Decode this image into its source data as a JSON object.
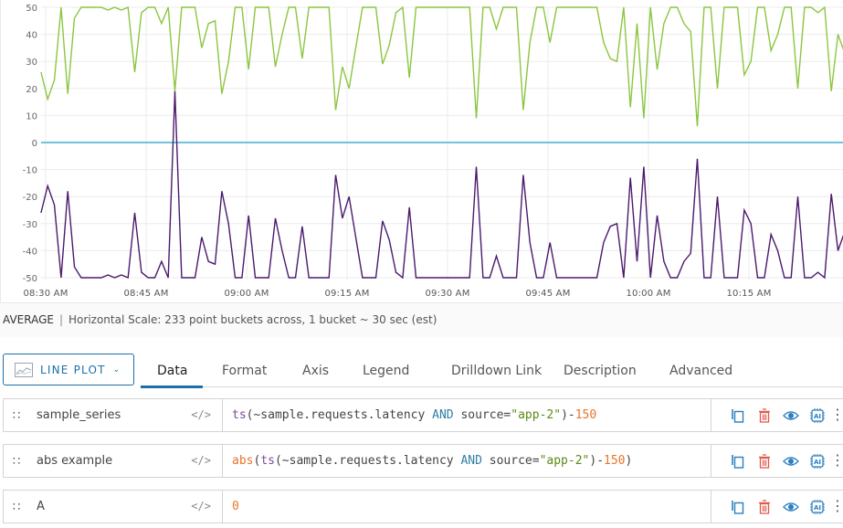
{
  "chart_data": {
    "type": "line",
    "title": "",
    "xlabel": "",
    "ylabel": "",
    "ylim": [
      -50,
      50
    ],
    "yticks": [
      50,
      40,
      30,
      20,
      10,
      0,
      -10,
      -20,
      -30,
      -40,
      -50
    ],
    "xtick_labels": [
      "08:30 AM",
      "08:45 AM",
      "09:00 AM",
      "09:15 AM",
      "09:30 AM",
      "09:45 AM",
      "10:00 AM",
      "10:15 AM"
    ],
    "x_start_minute_offset": -0.7,
    "x_minutes_per_point": 1,
    "grid": true,
    "legend": "none",
    "series": [
      {
        "name": "sample_series",
        "color": "#4b1a6e",
        "values": [
          -26,
          -16,
          -23,
          -50,
          -18,
          -46,
          -50,
          -50,
          -50,
          -50,
          -49,
          -50,
          -49,
          -50,
          -26,
          -48,
          -50,
          -50,
          -44,
          -50,
          19,
          -50,
          -50,
          -50,
          -35,
          -44,
          -45,
          -18,
          -30,
          -50,
          -50,
          -27,
          -50,
          -50,
          -50,
          -28,
          -40,
          -50,
          -50,
          -31,
          -50,
          -50,
          -50,
          -50,
          -12,
          -28,
          -20,
          -35,
          -50,
          -50,
          -50,
          -29,
          -36,
          -48,
          -50,
          -24,
          -50,
          -50,
          -50,
          -50,
          -50,
          -50,
          -50,
          -50,
          -50,
          -9,
          -50,
          -50,
          -42,
          -50,
          -50,
          -50,
          -12,
          -37,
          -50,
          -50,
          -37,
          -50,
          -50,
          -50,
          -50,
          -50,
          -50,
          -50,
          -37,
          -31,
          -30,
          -50,
          -13,
          -44,
          -9,
          -50,
          -27,
          -44,
          -50,
          -50,
          -44,
          -41,
          -6,
          -50,
          -50,
          -20,
          -50,
          -50,
          -50,
          -25,
          -30,
          -50,
          -50,
          -34,
          -40,
          -50,
          -50,
          -20,
          -50,
          -50,
          -48,
          -50,
          -19,
          -40,
          -33
        ]
      },
      {
        "name": "abs example",
        "color": "#8cc63f",
        "values": [
          26,
          16,
          23,
          50,
          18,
          46,
          50,
          50,
          50,
          50,
          49,
          50,
          49,
          50,
          26,
          48,
          50,
          50,
          44,
          50,
          19,
          50,
          50,
          50,
          35,
          44,
          45,
          18,
          30,
          50,
          50,
          27,
          50,
          50,
          50,
          28,
          40,
          50,
          50,
          31,
          50,
          50,
          50,
          50,
          12,
          28,
          20,
          35,
          50,
          50,
          50,
          29,
          36,
          48,
          50,
          24,
          50,
          50,
          50,
          50,
          50,
          50,
          50,
          50,
          50,
          9,
          50,
          50,
          42,
          50,
          50,
          50,
          12,
          37,
          50,
          50,
          37,
          50,
          50,
          50,
          50,
          50,
          50,
          50,
          37,
          31,
          30,
          50,
          13,
          44,
          9,
          50,
          27,
          44,
          50,
          50,
          44,
          41,
          6,
          50,
          50,
          20,
          50,
          50,
          50,
          25,
          30,
          50,
          50,
          34,
          40,
          50,
          50,
          20,
          50,
          50,
          48,
          50,
          19,
          40,
          33
        ]
      },
      {
        "name": "A",
        "color": "#6fc3dc",
        "constant": 0
      }
    ]
  },
  "status": {
    "aggregation": "AVERAGE",
    "separator": "|",
    "description": "Horizontal Scale: 233 point buckets across, 1 bucket ~ 30 sec (est)"
  },
  "toolbar": {
    "chart_type_label": "LINE PLOT",
    "chart_type_icon": "line-chart-icon",
    "chevron_icon": "chevron-down-icon",
    "tabs": [
      {
        "label": "Data",
        "active": true
      },
      {
        "label": "Format",
        "active": false
      },
      {
        "label": "Axis",
        "active": false
      },
      {
        "label": "Legend",
        "active": false
      },
      {
        "label": "Drilldown Link",
        "active": false
      },
      {
        "label": "Description",
        "active": false
      },
      {
        "label": "Advanced",
        "active": false
      }
    ]
  },
  "queries": [
    {
      "name": "sample_series",
      "code_toggle": "</>",
      "tokens": [
        {
          "t": "ts",
          "c": "fn1"
        },
        {
          "t": "(~sample.requests.latency ",
          "c": "plain"
        },
        {
          "t": "AND",
          "c": "kw"
        },
        {
          "t": " source=",
          "c": "plain"
        },
        {
          "t": "\"app-2\"",
          "c": "str"
        },
        {
          "t": ")-",
          "c": "plain"
        },
        {
          "t": "150",
          "c": "num"
        }
      ]
    },
    {
      "name": "abs example",
      "code_toggle": "</>",
      "tokens": [
        {
          "t": "abs",
          "c": "fn2"
        },
        {
          "t": "(",
          "c": "plain"
        },
        {
          "t": "ts",
          "c": "fn1"
        },
        {
          "t": "(~sample.requests.latency ",
          "c": "plain"
        },
        {
          "t": "AND",
          "c": "kw"
        },
        {
          "t": " source=",
          "c": "plain"
        },
        {
          "t": "\"app-2\"",
          "c": "str"
        },
        {
          "t": ")-",
          "c": "plain"
        },
        {
          "t": "150",
          "c": "num"
        },
        {
          "t": ")",
          "c": "plain"
        }
      ]
    },
    {
      "name": "A",
      "code_toggle": "</>",
      "tokens": [
        {
          "t": "0",
          "c": "num"
        }
      ]
    }
  ],
  "row_actions": [
    "copy-icon",
    "delete-icon",
    "eye-icon",
    "ai-icon",
    "more-icon"
  ],
  "colors": {
    "accent": "#1c6fa9",
    "delete": "#e05a4e",
    "action_blue": "#2a7fc0"
  }
}
